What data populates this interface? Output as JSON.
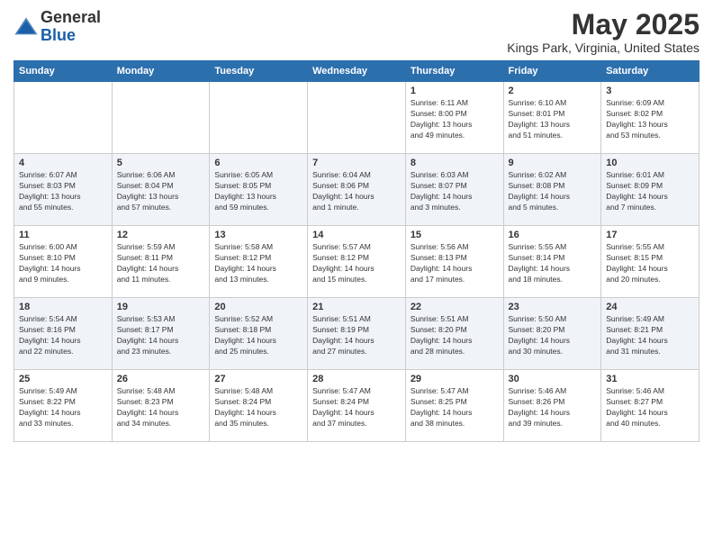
{
  "header": {
    "logo_line1": "General",
    "logo_line2": "Blue",
    "month_title": "May 2025",
    "location": "Kings Park, Virginia, United States"
  },
  "days_of_week": [
    "Sunday",
    "Monday",
    "Tuesday",
    "Wednesday",
    "Thursday",
    "Friday",
    "Saturday"
  ],
  "weeks": [
    [
      {
        "day": "",
        "info": ""
      },
      {
        "day": "",
        "info": ""
      },
      {
        "day": "",
        "info": ""
      },
      {
        "day": "",
        "info": ""
      },
      {
        "day": "1",
        "info": "Sunrise: 6:11 AM\nSunset: 8:00 PM\nDaylight: 13 hours\nand 49 minutes."
      },
      {
        "day": "2",
        "info": "Sunrise: 6:10 AM\nSunset: 8:01 PM\nDaylight: 13 hours\nand 51 minutes."
      },
      {
        "day": "3",
        "info": "Sunrise: 6:09 AM\nSunset: 8:02 PM\nDaylight: 13 hours\nand 53 minutes."
      }
    ],
    [
      {
        "day": "4",
        "info": "Sunrise: 6:07 AM\nSunset: 8:03 PM\nDaylight: 13 hours\nand 55 minutes."
      },
      {
        "day": "5",
        "info": "Sunrise: 6:06 AM\nSunset: 8:04 PM\nDaylight: 13 hours\nand 57 minutes."
      },
      {
        "day": "6",
        "info": "Sunrise: 6:05 AM\nSunset: 8:05 PM\nDaylight: 13 hours\nand 59 minutes."
      },
      {
        "day": "7",
        "info": "Sunrise: 6:04 AM\nSunset: 8:06 PM\nDaylight: 14 hours\nand 1 minute."
      },
      {
        "day": "8",
        "info": "Sunrise: 6:03 AM\nSunset: 8:07 PM\nDaylight: 14 hours\nand 3 minutes."
      },
      {
        "day": "9",
        "info": "Sunrise: 6:02 AM\nSunset: 8:08 PM\nDaylight: 14 hours\nand 5 minutes."
      },
      {
        "day": "10",
        "info": "Sunrise: 6:01 AM\nSunset: 8:09 PM\nDaylight: 14 hours\nand 7 minutes."
      }
    ],
    [
      {
        "day": "11",
        "info": "Sunrise: 6:00 AM\nSunset: 8:10 PM\nDaylight: 14 hours\nand 9 minutes."
      },
      {
        "day": "12",
        "info": "Sunrise: 5:59 AM\nSunset: 8:11 PM\nDaylight: 14 hours\nand 11 minutes."
      },
      {
        "day": "13",
        "info": "Sunrise: 5:58 AM\nSunset: 8:12 PM\nDaylight: 14 hours\nand 13 minutes."
      },
      {
        "day": "14",
        "info": "Sunrise: 5:57 AM\nSunset: 8:12 PM\nDaylight: 14 hours\nand 15 minutes."
      },
      {
        "day": "15",
        "info": "Sunrise: 5:56 AM\nSunset: 8:13 PM\nDaylight: 14 hours\nand 17 minutes."
      },
      {
        "day": "16",
        "info": "Sunrise: 5:55 AM\nSunset: 8:14 PM\nDaylight: 14 hours\nand 18 minutes."
      },
      {
        "day": "17",
        "info": "Sunrise: 5:55 AM\nSunset: 8:15 PM\nDaylight: 14 hours\nand 20 minutes."
      }
    ],
    [
      {
        "day": "18",
        "info": "Sunrise: 5:54 AM\nSunset: 8:16 PM\nDaylight: 14 hours\nand 22 minutes."
      },
      {
        "day": "19",
        "info": "Sunrise: 5:53 AM\nSunset: 8:17 PM\nDaylight: 14 hours\nand 23 minutes."
      },
      {
        "day": "20",
        "info": "Sunrise: 5:52 AM\nSunset: 8:18 PM\nDaylight: 14 hours\nand 25 minutes."
      },
      {
        "day": "21",
        "info": "Sunrise: 5:51 AM\nSunset: 8:19 PM\nDaylight: 14 hours\nand 27 minutes."
      },
      {
        "day": "22",
        "info": "Sunrise: 5:51 AM\nSunset: 8:20 PM\nDaylight: 14 hours\nand 28 minutes."
      },
      {
        "day": "23",
        "info": "Sunrise: 5:50 AM\nSunset: 8:20 PM\nDaylight: 14 hours\nand 30 minutes."
      },
      {
        "day": "24",
        "info": "Sunrise: 5:49 AM\nSunset: 8:21 PM\nDaylight: 14 hours\nand 31 minutes."
      }
    ],
    [
      {
        "day": "25",
        "info": "Sunrise: 5:49 AM\nSunset: 8:22 PM\nDaylight: 14 hours\nand 33 minutes."
      },
      {
        "day": "26",
        "info": "Sunrise: 5:48 AM\nSunset: 8:23 PM\nDaylight: 14 hours\nand 34 minutes."
      },
      {
        "day": "27",
        "info": "Sunrise: 5:48 AM\nSunset: 8:24 PM\nDaylight: 14 hours\nand 35 minutes."
      },
      {
        "day": "28",
        "info": "Sunrise: 5:47 AM\nSunset: 8:24 PM\nDaylight: 14 hours\nand 37 minutes."
      },
      {
        "day": "29",
        "info": "Sunrise: 5:47 AM\nSunset: 8:25 PM\nDaylight: 14 hours\nand 38 minutes."
      },
      {
        "day": "30",
        "info": "Sunrise: 5:46 AM\nSunset: 8:26 PM\nDaylight: 14 hours\nand 39 minutes."
      },
      {
        "day": "31",
        "info": "Sunrise: 5:46 AM\nSunset: 8:27 PM\nDaylight: 14 hours\nand 40 minutes."
      }
    ]
  ]
}
